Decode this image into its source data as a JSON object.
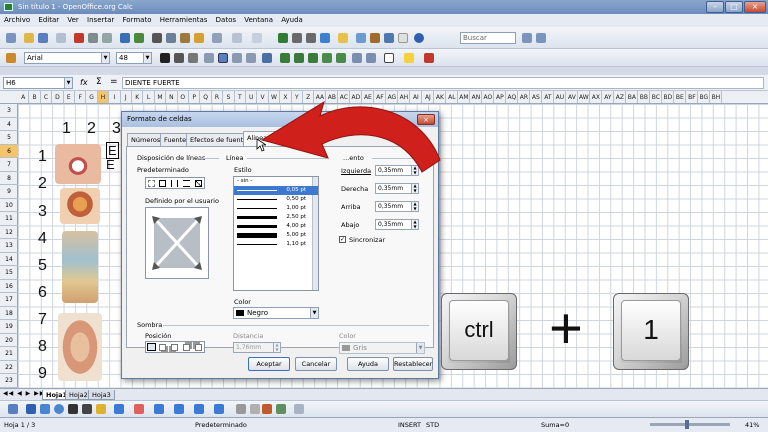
{
  "window": {
    "title": "Sin título 1 - OpenOffice.org Calc"
  },
  "menu": [
    "Archivo",
    "Editar",
    "Ver",
    "Insertar",
    "Formato",
    "Herramientas",
    "Datos",
    "Ventana",
    "Ayuda"
  ],
  "toolbar": {
    "font_name": "Arial",
    "font_size": "48",
    "search_placeholder": "Buscar"
  },
  "formula": {
    "cell_ref": "H6",
    "fx": "fx",
    "sum": "Σ",
    "eq": "=",
    "content": "DIENTE FUERTE"
  },
  "columns": [
    "A",
    "B",
    "C",
    "D",
    "E",
    "F",
    "G",
    "H",
    "I",
    "J",
    "K",
    "L",
    "M",
    "N",
    "O",
    "P",
    "Q",
    "R",
    "S",
    "T",
    "U",
    "V",
    "W",
    "X",
    "Y",
    "Z",
    "AA",
    "AB",
    "AC",
    "AD",
    "AE",
    "AF",
    "AG",
    "AH",
    "AI",
    "AJ",
    "AK",
    "AL",
    "AM",
    "AN",
    "AO",
    "AP",
    "AQ",
    "AR",
    "AS",
    "AT",
    "AU",
    "AV",
    "AW",
    "AX",
    "AY",
    "AZ",
    "BA",
    "BB",
    "BC",
    "BD",
    "BE",
    "BF",
    "BG",
    "BH"
  ],
  "rows": [
    "3",
    "4",
    "5",
    "6",
    "7",
    "8",
    "9",
    "10",
    "11",
    "12",
    "13",
    "14",
    "15",
    "16",
    "17",
    "18",
    "19",
    "20",
    "21",
    "22",
    "23"
  ],
  "cells": {
    "header_numbers": [
      "1",
      "2",
      "3"
    ],
    "row_numbers": [
      "1",
      "2",
      "3",
      "4",
      "5",
      "6",
      "7",
      "8",
      "9"
    ],
    "h_letters": [
      "E",
      "E"
    ]
  },
  "sheet_tabs": [
    "Hoja1",
    "Hoja2",
    "Hoja3"
  ],
  "dialog": {
    "title": "Formato de celdas",
    "tabs": [
      "Números",
      "Fuente",
      "Efectos de fuente",
      "Alineación"
    ],
    "disposicion_label": "Disposición de líneas",
    "predeterminado_label": "Predeterminado",
    "definido_label": "Definido por el usuario",
    "linea_label": "Línea",
    "estilo_label": "Estilo",
    "line_styles": [
      {
        "label": "- sin -",
        "weight": 0
      },
      {
        "label": "0,05 pt",
        "weight": 1,
        "selected": true
      },
      {
        "label": "0,50 pt",
        "weight": 1
      },
      {
        "label": "1,00 pt",
        "weight": 1.5
      },
      {
        "label": "2,50 pt",
        "weight": 2.5
      },
      {
        "label": "4,00 pt",
        "weight": 3.5
      },
      {
        "label": "5,00 pt",
        "weight": 4.5
      },
      {
        "label": "1,10 pt",
        "weight": 1.5
      }
    ],
    "color_label": "Color",
    "color_value": "Negro",
    "espacio_label": "...ento",
    "izquierda_label": "Izquierda",
    "izquierda_value": "0,35mm",
    "derecha_label": "Derecha",
    "derecha_value": "0,35mm",
    "arriba_label": "Arriba",
    "arriba_value": "0,35mm",
    "abajo_label": "Abajo",
    "abajo_value": "0,35mm",
    "sincronizar_label": "Sincronizar",
    "sombra_label": "Sombra",
    "posicion_label": "Posición",
    "distancia_label": "Distancia",
    "distancia_value": "1,76mm",
    "sombra_color_label": "Color",
    "sombra_color_value": "Gris",
    "buttons": {
      "aceptar": "Aceptar",
      "cancelar": "Cancelar",
      "ayuda": "Ayuda",
      "restablecer": "Restablecer"
    }
  },
  "keys": {
    "ctrl": "ctrl",
    "plus": "+",
    "one": "1"
  },
  "status": {
    "sheet": "Hoja 1 / 3",
    "style": "Predeterminado",
    "insert": "INSERT",
    "std": "STD",
    "sum": "Suma=0",
    "zoom": "41%"
  },
  "colors": {
    "arrow": "#d0201c",
    "selection": "#3d79d0"
  }
}
